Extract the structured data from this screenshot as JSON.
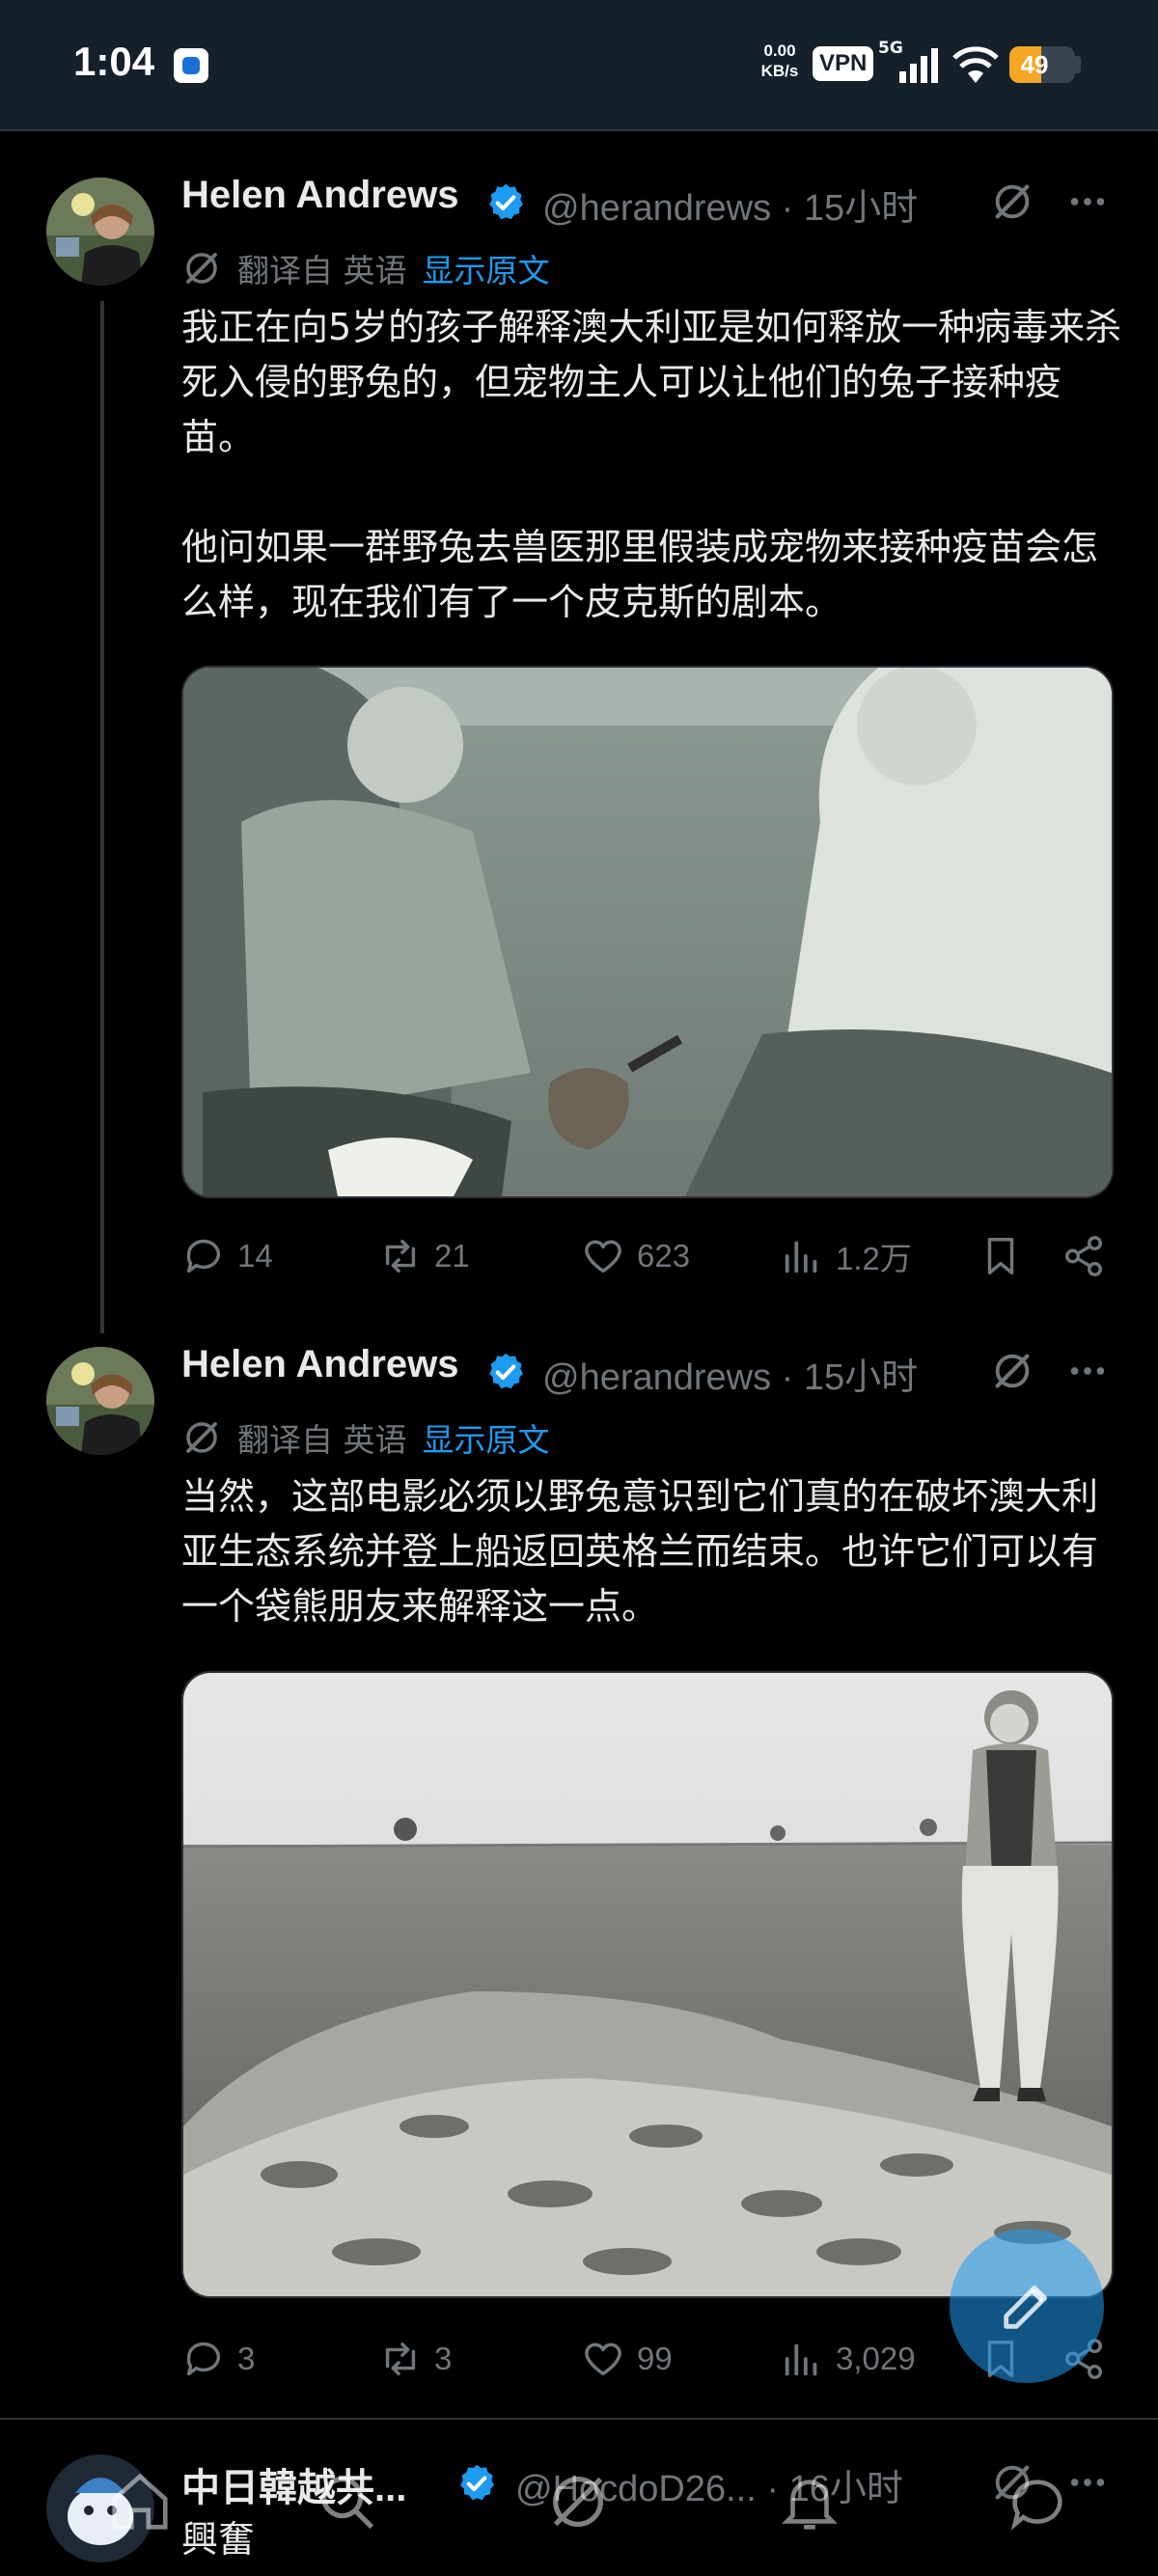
{
  "status_bar": {
    "time": "1:04",
    "net_speed_value": "0.00",
    "net_speed_unit": "KB/s",
    "vpn_label": "VPN",
    "network_type": "5G",
    "battery_level": "49",
    "battery_fraction": 0.49,
    "battery_color": "#f5a623"
  },
  "colors": {
    "background": "#000000",
    "text": "#e7e9ea",
    "muted": "#71767b",
    "link": "#1d9bf0",
    "verified": "#1d9bf0",
    "divider": "#2f3336"
  },
  "tweets": [
    {
      "author_name": "Helen Andrews",
      "verified": true,
      "meta": "@herandrews · 15小时",
      "translated_from": "翻译自 英语",
      "show_original": "显示原文",
      "text": "我正在向5岁的孩子解释澳大利亚是如何释放一种病毒来杀死入侵的野兔的，但宠物主人可以让他们的兔子接种疫苗。\n\n他问如果一群野兔去兽医那里假装成宠物来接种疫苗会怎么样，现在我们有了一个皮克斯的剧本。",
      "media_icon": "photo-two-men-with-rabbit",
      "replies": "14",
      "reposts": "21",
      "likes": "623",
      "views": "1.2万"
    },
    {
      "author_name": "Helen Andrews",
      "verified": true,
      "meta": "@herandrews · 15小时",
      "translated_from": "翻译自 英语",
      "show_original": "显示原文",
      "text": "当然，这部电影必须以野兔意识到它们真的在破坏澳大利亚生态系统并登上船返回英格兰而结束。也许它们可以有一个袋熊朋友来解释这一点。",
      "media_icon": "photo-woman-beside-rabbit-pile",
      "replies": "3",
      "reposts": "3",
      "likes": "99",
      "views": "3,029"
    },
    {
      "author_name": "中日韓越共...",
      "verified": true,
      "meta": "@HocdoD26... · 16小时",
      "text": "興奮"
    }
  ],
  "fab_icon": "compose-icon",
  "bottom_nav_icons": [
    "home-icon",
    "search-icon",
    "grok-icon",
    "notifications-icon",
    "messages-icon"
  ]
}
